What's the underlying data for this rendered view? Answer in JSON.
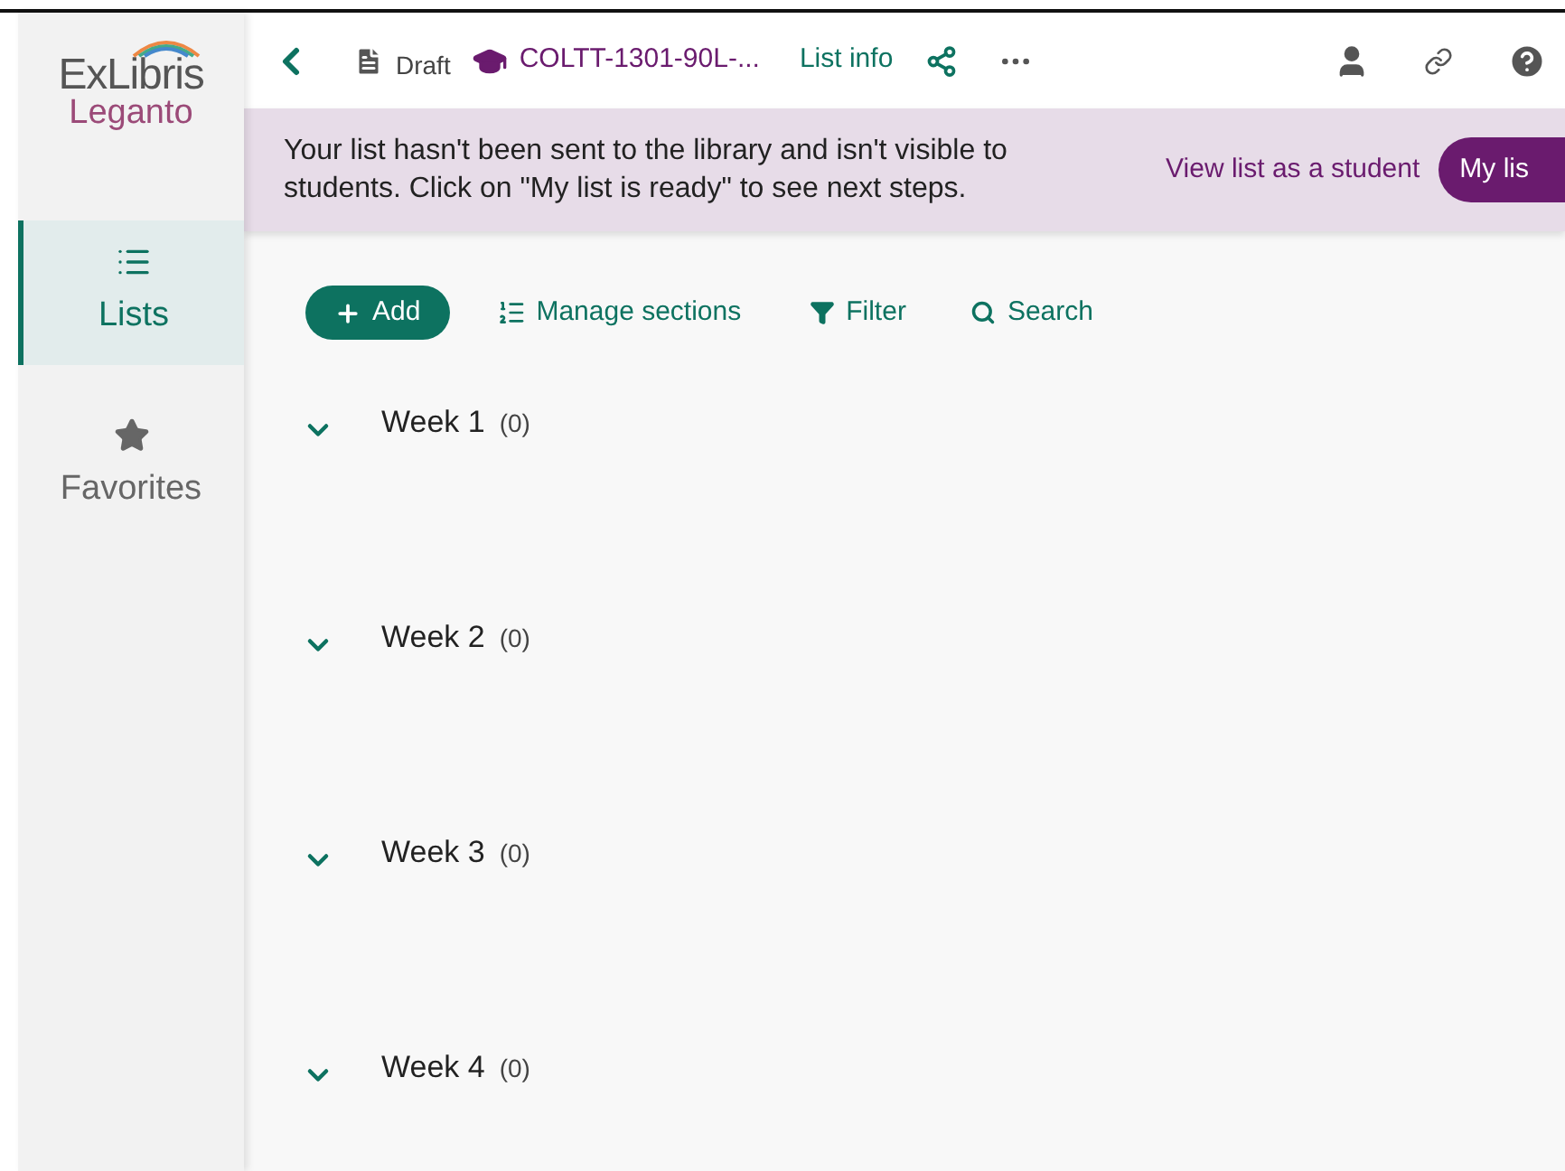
{
  "logo": {
    "brand": "ExLibris",
    "product": "Leganto"
  },
  "sidebar": {
    "items": [
      {
        "kind": "list",
        "label": "Lists",
        "selected": true
      },
      {
        "kind": "star",
        "label": "Favorites",
        "selected": false
      }
    ]
  },
  "header": {
    "status": "Draft",
    "course": "COLTT-1301-90L-...",
    "list_info": "List info"
  },
  "banner": {
    "message": "Your list hasn't been sent to the library and isn't visible to students. Click on \"My list is ready\" to see next steps.",
    "link": "View list as a student",
    "button": "My lis"
  },
  "toolbar": {
    "add": "Add",
    "manage": "Manage sections",
    "filter": "Filter",
    "search": "Search"
  },
  "sections": [
    {
      "title": "Week 1",
      "count": "(0)",
      "expanded": false
    },
    {
      "title": "Week 2",
      "count": "(0)",
      "expanded": false
    },
    {
      "title": "Week 3",
      "count": "(0)",
      "expanded": false
    },
    {
      "title": "Week 4",
      "count": "(0)",
      "expanded": false
    }
  ]
}
